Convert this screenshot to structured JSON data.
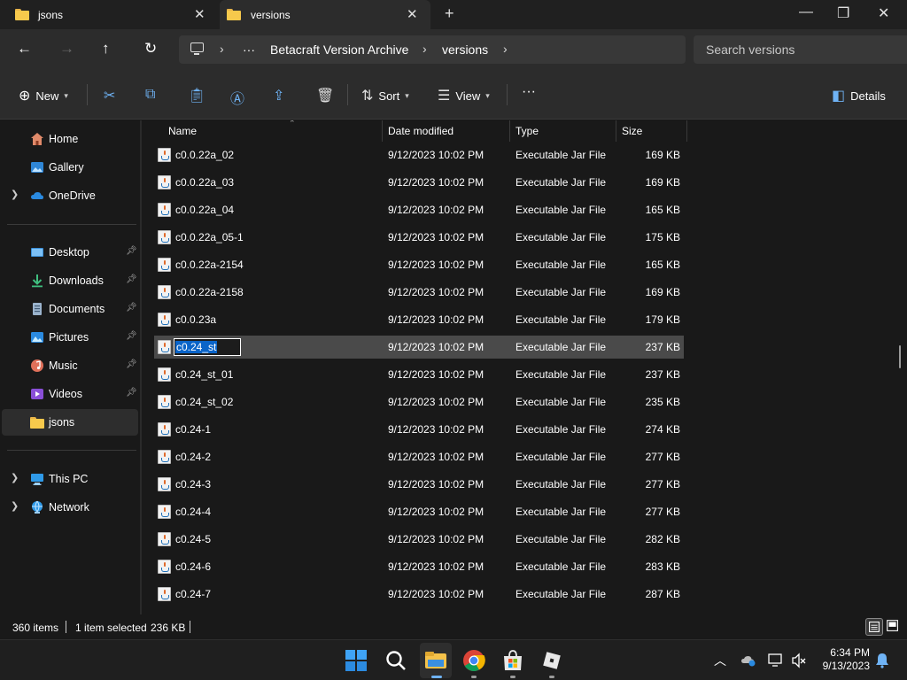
{
  "tabs": [
    {
      "label": "jsons"
    },
    {
      "label": "versions"
    }
  ],
  "window": {
    "minimize": "—",
    "maximize": "❐",
    "close": "✕",
    "new_tab": "+"
  },
  "address": {
    "breadcrumbs": [
      "Betacraft Version Archive",
      "versions"
    ],
    "overflow": "···"
  },
  "search": {
    "placeholder": "Search versions"
  },
  "commands": {
    "new": "New",
    "sort": "Sort",
    "view": "View",
    "more": "···",
    "details": "Details"
  },
  "sidebar": {
    "items": [
      {
        "label": "Home"
      },
      {
        "label": "Gallery"
      },
      {
        "label": "OneDrive"
      },
      {
        "label": "Desktop"
      },
      {
        "label": "Downloads"
      },
      {
        "label": "Documents"
      },
      {
        "label": "Pictures"
      },
      {
        "label": "Music"
      },
      {
        "label": "Videos"
      },
      {
        "label": "jsons"
      },
      {
        "label": "This PC"
      },
      {
        "label": "Network"
      }
    ]
  },
  "columns": {
    "name": "Name",
    "date": "Date modified",
    "type": "Type",
    "size": "Size"
  },
  "files": [
    {
      "name": "c0.0.22a_02",
      "date": "9/12/2023 10:02 PM",
      "type": "Executable Jar File",
      "size": "169 KB"
    },
    {
      "name": "c0.0.22a_03",
      "date": "9/12/2023 10:02 PM",
      "type": "Executable Jar File",
      "size": "169 KB"
    },
    {
      "name": "c0.0.22a_04",
      "date": "9/12/2023 10:02 PM",
      "type": "Executable Jar File",
      "size": "165 KB"
    },
    {
      "name": "c0.0.22a_05-1",
      "date": "9/12/2023 10:02 PM",
      "type": "Executable Jar File",
      "size": "175 KB"
    },
    {
      "name": "c0.0.22a-2154",
      "date": "9/12/2023 10:02 PM",
      "type": "Executable Jar File",
      "size": "165 KB"
    },
    {
      "name": "c0.0.22a-2158",
      "date": "9/12/2023 10:02 PM",
      "type": "Executable Jar File",
      "size": "169 KB"
    },
    {
      "name": "c0.0.23a",
      "date": "9/12/2023 10:02 PM",
      "type": "Executable Jar File",
      "size": "179 KB"
    },
    {
      "name": "c0.24_st",
      "date": "9/12/2023 10:02 PM",
      "type": "Executable Jar File",
      "size": "237 KB"
    },
    {
      "name": "c0.24_st_01",
      "date": "9/12/2023 10:02 PM",
      "type": "Executable Jar File",
      "size": "237 KB"
    },
    {
      "name": "c0.24_st_02",
      "date": "9/12/2023 10:02 PM",
      "type": "Executable Jar File",
      "size": "235 KB"
    },
    {
      "name": "c0.24-1",
      "date": "9/12/2023 10:02 PM",
      "type": "Executable Jar File",
      "size": "274 KB"
    },
    {
      "name": "c0.24-2",
      "date": "9/12/2023 10:02 PM",
      "type": "Executable Jar File",
      "size": "277 KB"
    },
    {
      "name": "c0.24-3",
      "date": "9/12/2023 10:02 PM",
      "type": "Executable Jar File",
      "size": "277 KB"
    },
    {
      "name": "c0.24-4",
      "date": "9/12/2023 10:02 PM",
      "type": "Executable Jar File",
      "size": "277 KB"
    },
    {
      "name": "c0.24-5",
      "date": "9/12/2023 10:02 PM",
      "type": "Executable Jar File",
      "size": "282 KB"
    },
    {
      "name": "c0.24-6",
      "date": "9/12/2023 10:02 PM",
      "type": "Executable Jar File",
      "size": "283 KB"
    },
    {
      "name": "c0.24-7",
      "date": "9/12/2023 10:02 PM",
      "type": "Executable Jar File",
      "size": "287 KB"
    }
  ],
  "selected_index": 7,
  "rename_value": "c0.24_st",
  "status": {
    "count": "360 items",
    "selection": "1 item selected",
    "sel_size": "236 KB"
  },
  "clock": {
    "time": "6:34 PM",
    "date": "9/13/2023"
  },
  "colors": {
    "accent": "#0a64c8",
    "folder": "#f7c94c",
    "selected_row": "#4a4a4a"
  }
}
